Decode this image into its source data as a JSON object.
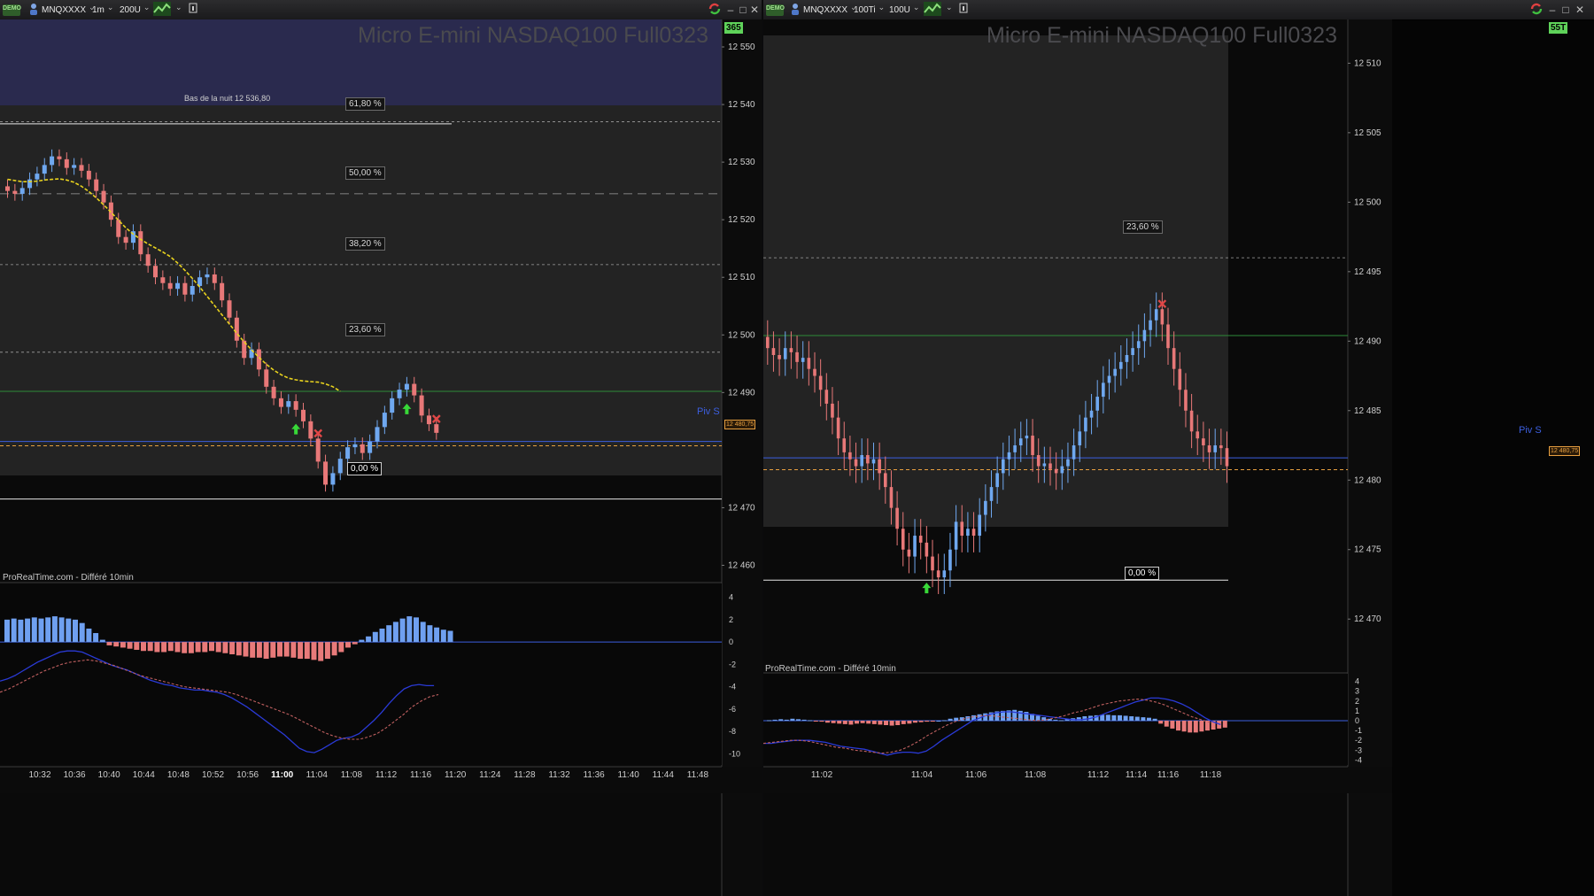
{
  "colors": {
    "up": "#6fa8f0",
    "down": "#e87878",
    "ma": "#e8d21e",
    "fib": "#a0a0a0",
    "green_line": "#2e8b3a",
    "pivot": "#3c5fe0",
    "close_line": "#e8a040",
    "macd_line": "#2a3ad6",
    "signal_line": "#c06060",
    "hist_up": "#6fa0f0",
    "hist_down": "#e87a7a",
    "buy_arrow": "#38d838",
    "sell_cross": "#e04646",
    "night_bg": "#2a2a4e",
    "panel_bg": "#232323"
  },
  "left": {
    "toolbar": {
      "demo": "DEMO",
      "symbol": "MNQXXXX",
      "timeframe": "1m",
      "units": "200U",
      "icons": [
        "person-icon",
        "indicator-chart-icon",
        "info-icon",
        "refresh-icon",
        "minimize-icon",
        "maximize-icon",
        "close-icon"
      ],
      "bar_counter": "365"
    },
    "instrument": "Micro E-mini NASDAQ100 Full0323",
    "credit": "ProRealTime.com - Différé 10min",
    "night_low_label": "Bas de la nuit 12 536,80",
    "fib_labels": [
      "61,80 %",
      "50,00 %",
      "38,20 %",
      "23,60 %",
      "0,00 %"
    ],
    "fib_prices": [
      12537.0,
      12524.5,
      12512.2,
      12497.0,
      12471.5
    ],
    "pivot_label": "Piv S",
    "pivot_price": 12481.5,
    "green_price": 12490.2,
    "close_price": 12480.75,
    "close_label": "12 480,75",
    "price_axis": {
      "labels": [
        "12 550",
        "12 540",
        "12 530",
        "12 520",
        "12 510",
        "12 500",
        "12 490",
        "12 470",
        "12 460"
      ],
      "values": [
        12550,
        12540,
        12530,
        12520,
        12510,
        12500,
        12490,
        12470,
        12460
      ]
    },
    "macd_axis": {
      "labels": [
        "4",
        "2",
        "0",
        "-2",
        "-4",
        "-6",
        "-8",
        "-10"
      ],
      "values": [
        4,
        2,
        0,
        -2,
        -4,
        -6,
        -8,
        -10
      ]
    },
    "time_axis": [
      "10:32",
      "10:36",
      "10:40",
      "10:44",
      "10:48",
      "10:52",
      "10:56",
      "11:00",
      "11:04",
      "11:08",
      "11:12",
      "11:16",
      "11:20",
      "11:24",
      "11:28",
      "11:32",
      "11:36",
      "11:40",
      "11:44",
      "11:48"
    ],
    "time_axis_bold": "11:00",
    "chart_data": {
      "type": "candlestick",
      "closes": [
        12525,
        12524.5,
        12525.5,
        12527,
        12528,
        12529.5,
        12531,
        12530.5,
        12529,
        12529.5,
        12528.5,
        12527,
        12525,
        12523,
        12520,
        12517,
        12516,
        12518,
        12514,
        12512,
        12510,
        12509,
        12508,
        12509,
        12507,
        12508.5,
        12510,
        12510.5,
        12509,
        12506,
        12503,
        12499,
        12496,
        12497.5,
        12494,
        12491,
        12489,
        12487.5,
        12488.5,
        12487,
        12485,
        12482,
        12478,
        12474,
        12476,
        12478.5,
        12480.5,
        12481,
        12479.5,
        12481.5,
        12484,
        12486.5,
        12489,
        12490.5,
        12491.5,
        12489.5,
        12486,
        12484.5,
        12483
      ],
      "ma": [
        12527,
        12526.8,
        12526.6,
        12526.6,
        12526.7,
        12526.9,
        12527.0,
        12527.1,
        12526.9,
        12526.5,
        12525.8,
        12524.9,
        12523.8,
        12522.6,
        12521.3,
        12519.9,
        12518.6,
        12517.5,
        12516.6,
        12515.8,
        12515.1,
        12514.4,
        12513.6,
        12512.5,
        12511.2,
        12509.8,
        12508.3,
        12506.7,
        12505.1,
        12503.5,
        12501.9,
        12500.3,
        12498.8,
        12497.4,
        12496.1,
        12494.9,
        12493.9,
        12493.1,
        12492.5,
        12492.2,
        12492.0,
        12491.9,
        12491.8,
        12491.5,
        12491.0,
        12490.2
      ],
      "ma_start": 0,
      "buy_signals": [
        39,
        54
      ],
      "sell_signals": [
        42,
        72
      ],
      "macd_hist": [
        2.0,
        2.1,
        2.0,
        2.1,
        2.2,
        2.1,
        2.2,
        2.3,
        2.2,
        2.1,
        2.0,
        1.7,
        1.2,
        0.8,
        0.2,
        -0.3,
        -0.4,
        -0.5,
        -0.6,
        -0.7,
        -0.8,
        -0.8,
        -0.9,
        -0.9,
        -0.8,
        -0.9,
        -1.0,
        -1.0,
        -0.9,
        -0.9,
        -0.8,
        -0.9,
        -1.0,
        -1.1,
        -1.2,
        -1.3,
        -1.4,
        -1.4,
        -1.5,
        -1.4,
        -1.3,
        -1.3,
        -1.4,
        -1.5,
        -1.5,
        -1.6,
        -1.7,
        -1.5,
        -1.2,
        -0.9,
        -0.5,
        -0.2,
        0.2,
        0.5,
        0.9,
        1.2,
        1.5,
        1.8,
        2.1,
        2.3,
        2.2,
        1.8,
        1.5,
        1.3,
        1.1,
        1.0
      ],
      "macd_line": [
        -3.5,
        -3.3,
        -3.0,
        -2.6,
        -2.2,
        -1.8,
        -1.5,
        -1.2,
        -0.9,
        -0.8,
        -0.8,
        -0.9,
        -1.2,
        -1.5,
        -1.8,
        -2.1,
        -2.3,
        -2.5,
        -2.8,
        -3.1,
        -3.4,
        -3.6,
        -3.8,
        -3.9,
        -4.1,
        -4.2,
        -4.3,
        -4.3,
        -4.4,
        -4.5,
        -4.7,
        -5.0,
        -5.4,
        -5.8,
        -6.3,
        -6.8,
        -7.3,
        -7.8,
        -8.3,
        -8.9,
        -9.5,
        -9.8,
        -9.9,
        -9.6,
        -9.2,
        -8.8,
        -8.6,
        -8.5,
        -8.2,
        -7.6,
        -7.0,
        -6.3,
        -5.5,
        -4.8,
        -4.2,
        -3.9,
        -3.8,
        -3.9,
        -3.9
      ],
      "signal_line": [
        -4.5,
        -4.2,
        -3.8,
        -3.4,
        -3.0,
        -2.6,
        -2.3,
        -2.0,
        -1.8,
        -1.7,
        -1.6,
        -1.7,
        -1.9,
        -2.1,
        -2.4,
        -2.7,
        -3.0,
        -3.2,
        -3.4,
        -3.6,
        -3.8,
        -4.0,
        -4.1,
        -4.2,
        -4.3,
        -4.4,
        -4.5,
        -4.7,
        -5.0,
        -5.3,
        -5.6,
        -5.9,
        -6.2,
        -6.5,
        -6.9,
        -7.3,
        -7.7,
        -8.1,
        -8.4,
        -8.6,
        -8.7,
        -8.7,
        -8.5,
        -8.2,
        -7.7,
        -7.1,
        -6.5,
        -5.8,
        -5.3,
        -4.9,
        -4.7
      ]
    }
  },
  "right": {
    "toolbar": {
      "demo": "DEMO",
      "symbol": "MNQXXXX",
      "timeframe": "100Ti",
      "units": "100U",
      "icons": [
        "person-icon",
        "indicator-chart-icon",
        "info-icon",
        "refresh-icon",
        "minimize-icon",
        "maximize-icon",
        "close-icon"
      ],
      "bar_counter": "55T"
    },
    "instrument": "Micro E-mini NASDAQ100 Full0323",
    "credit": "ProRealTime.com - Différé 10min",
    "fib_labels": [
      "23,60 %",
      "0,00 %"
    ],
    "fib_prices": [
      12496.0,
      12472.8
    ],
    "pivot_label": "Piv S",
    "pivot_price": 12481.6,
    "green_price": 12490.4,
    "close_price": 12480.75,
    "close_label": "12 480,75",
    "price_axis": {
      "labels": [
        "12 510",
        "12 505",
        "12 500",
        "12 495",
        "12 490",
        "12 485",
        "12 480",
        "12 475",
        "12 470"
      ],
      "values": [
        12510,
        12505,
        12500,
        12495,
        12490,
        12485,
        12480,
        12475,
        12470
      ]
    },
    "macd_axis": {
      "labels": [
        "4",
        "3",
        "2",
        "1",
        "0",
        "-1",
        "-2",
        "-3",
        "-4"
      ],
      "values": [
        4,
        3,
        2,
        1,
        0,
        -1,
        -2,
        -3,
        -4
      ]
    },
    "time_axis": [
      "11:02",
      "11:04",
      "11:06",
      "11:08",
      "11:12",
      "11:14",
      "11:16",
      "11:18"
    ],
    "chart_data": {
      "type": "candlestick",
      "closes": [
        12489.5,
        12489,
        12488.7,
        12489.5,
        12489.2,
        12488.5,
        12488.8,
        12488,
        12487.5,
        12486.5,
        12485.5,
        12484.5,
        12483,
        12482,
        12481.5,
        12481,
        12481.8,
        12481.2,
        12481.5,
        12480.5,
        12479.5,
        12478,
        12476.5,
        12475,
        12474.5,
        12476,
        12475.5,
        12474.5,
        12473.5,
        12473,
        12473.5,
        12475,
        12477,
        12476,
        12476.5,
        12476,
        12477.5,
        12478.5,
        12479.5,
        12480.5,
        12481.5,
        12482,
        12482.5,
        12483,
        12483.2,
        12481.8,
        12481,
        12481.2,
        12480.8,
        12480.5,
        12481,
        12481.5,
        12482.5,
        12483.5,
        12484.5,
        12485,
        12486,
        12487,
        12487.5,
        12488,
        12488.5,
        12489,
        12489.5,
        12490,
        12490.8,
        12491.5,
        12492.3,
        12491.2,
        12489.5,
        12488,
        12486.5,
        12485,
        12483.5,
        12483,
        12482.5,
        12482,
        12482.5,
        12482.3,
        12481
      ],
      "buy_signals": [
        27
      ],
      "sell_signals": [
        67
      ],
      "macd_hist": [
        0.05,
        0.1,
        0.15,
        0.1,
        0.2,
        0.15,
        0.1,
        0.05,
        -0.05,
        -0.1,
        -0.2,
        -0.25,
        -0.3,
        -0.35,
        -0.4,
        -0.3,
        -0.25,
        -0.3,
        -0.35,
        -0.4,
        -0.45,
        -0.5,
        -0.45,
        -0.35,
        -0.3,
        -0.2,
        -0.15,
        -0.1,
        -0.05,
        0.0,
        0.05,
        0.2,
        0.3,
        0.35,
        0.45,
        0.55,
        0.65,
        0.75,
        0.85,
        0.95,
        1.0,
        1.05,
        1.1,
        1.0,
        0.9,
        0.7,
        0.5,
        0.35,
        0.2,
        0.1,
        0.05,
        0.15,
        0.25,
        0.35,
        0.45,
        0.5,
        0.55,
        0.6,
        0.6,
        0.55,
        0.55,
        0.5,
        0.45,
        0.4,
        0.35,
        0.3,
        0.2,
        -0.3,
        -0.6,
        -0.8,
        -1.0,
        -1.1,
        -1.2,
        -1.2,
        -1.1,
        -1.0,
        -0.9,
        -0.8,
        -0.7
      ],
      "macd_line": [
        -2.3,
        -2.3,
        -2.2,
        -2.1,
        -2.0,
        -2.0,
        -2.0,
        -2.1,
        -2.2,
        -2.4,
        -2.6,
        -2.7,
        -2.8,
        -2.9,
        -3.1,
        -3.3,
        -3.5,
        -3.3,
        -3.2,
        -3.2,
        -3.3,
        -3.1,
        -2.6,
        -2.0,
        -1.5,
        -1.0,
        -0.5,
        0.0,
        0.3,
        0.6,
        0.8,
        0.9,
        0.9,
        0.8,
        0.7,
        0.6,
        0.5,
        0.4,
        0.3,
        0.2,
        0.1,
        0.1,
        0.2,
        0.4,
        0.7,
        1.0,
        1.3,
        1.6,
        1.9,
        2.1,
        2.3,
        2.3,
        2.2,
        2.0,
        1.7,
        1.3,
        0.8,
        0.3,
        -0.1,
        -0.4
      ],
      "signal_line": [
        -2.3,
        -2.2,
        -2.1,
        -2.0,
        -2.0,
        -2.1,
        -2.3,
        -2.5,
        -2.7,
        -2.8,
        -3.0,
        -3.1,
        -3.2,
        -3.3,
        -3.2,
        -3.0,
        -2.6,
        -2.1,
        -1.5,
        -1.0,
        -0.5,
        -0.1,
        0.2,
        0.4,
        0.5,
        0.5,
        0.4,
        0.3,
        0.2,
        0.1,
        0.0,
        0.1,
        0.3,
        0.5,
        0.8,
        1.0,
        1.3,
        1.6,
        1.8,
        2.0,
        2.1,
        2.2,
        2.1,
        1.9,
        1.6,
        1.2,
        0.8,
        0.4,
        0.1,
        -0.2
      ]
    }
  }
}
